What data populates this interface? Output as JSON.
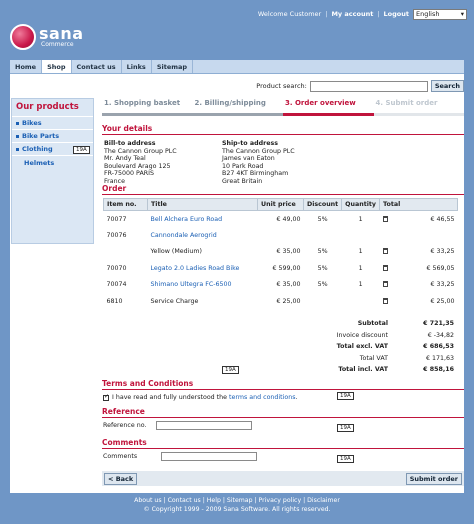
{
  "header": {
    "welcome": "Welcome Customer",
    "my_account": "My account",
    "logout": "Logout",
    "language": "English",
    "sep": "|",
    "logo_main": "sana",
    "logo_sub": "Commerce"
  },
  "nav": [
    "Home",
    "Shop",
    "Contact us",
    "Links",
    "Sitemap"
  ],
  "search": {
    "label": "Product search:",
    "button": "Search",
    "value": ""
  },
  "sidebar": {
    "title": "Our products",
    "items": [
      "Bikes",
      "Bike Parts",
      "Clothing"
    ],
    "sub": "Helmets",
    "tag": "19A"
  },
  "steps": [
    "1. Shopping basket",
    "2. Billing/shipping",
    "3. Order overview",
    "4. Submit order"
  ],
  "details": {
    "title": "Your details",
    "bill_title": "Bill-to address",
    "bill": [
      "The Cannon Group PLC",
      "Mr. Andy Teal",
      "Boulevard Arago 125",
      "FR-75000 PARIS",
      "France"
    ],
    "ship_title": "Ship-to address",
    "ship": [
      "The Cannon Group PLC",
      "James van Eaton",
      "10 Park Road",
      "B27 4KT Birmingham",
      "Great Britain"
    ]
  },
  "order": {
    "title": "Order",
    "headers": [
      "Item no.",
      "Title",
      "Unit price",
      "Discount",
      "Quantity",
      "Total"
    ],
    "rows": [
      {
        "item": "70077",
        "title": "Bell Alchera Euro Road",
        "link": true,
        "price": "€ 49,00",
        "disc": "5%",
        "qty": "1",
        "total": "€ 46,55",
        "trash": true
      },
      {
        "item": "70076",
        "title": "Cannondale Aerogrid",
        "link": true,
        "price": "",
        "disc": "",
        "qty": "",
        "total": "",
        "trash": false
      },
      {
        "item": "",
        "title": "Yellow (Medium)",
        "link": false,
        "price": "€ 35,00",
        "disc": "5%",
        "qty": "1",
        "total": "€ 33,25",
        "trash": true
      },
      {
        "item": "70070",
        "title": "Legato 2.0 Ladies Road Bike",
        "link": true,
        "price": "€ 599,00",
        "disc": "5%",
        "qty": "1",
        "total": "€ 569,05",
        "trash": true
      },
      {
        "item": "70074",
        "title": "Shimano Ultegra FC-6500",
        "link": true,
        "price": "€ 35,00",
        "disc": "5%",
        "qty": "1",
        "total": "€ 33,25",
        "trash": true
      },
      {
        "item": "6810",
        "title": "Service Charge",
        "link": false,
        "price": "€ 25,00",
        "disc": "",
        "qty": "",
        "total": "€ 25,00",
        "trash": true
      }
    ],
    "totals": [
      {
        "label": "Subtotal",
        "value": "€ 721,35",
        "bold": true
      },
      {
        "label": "Invoice discount",
        "value": "€ -34,82",
        "bold": false
      },
      {
        "label": "Total excl. VAT",
        "value": "€ 686,53",
        "bold": true
      },
      {
        "label": "Total VAT",
        "value": "€ 171,63",
        "bold": false
      },
      {
        "label": "Total incl. VAT",
        "value": "€ 858,16",
        "bold": true
      }
    ]
  },
  "terms": {
    "title": "Terms and Conditions",
    "text_pre": "I have read and fully understood the",
    "link": "terms and conditions",
    "text_post": "."
  },
  "reference": {
    "title": "Reference",
    "label": "Reference no."
  },
  "comments": {
    "title": "Comments",
    "label": "Comments"
  },
  "tags": [
    "19A",
    "19A",
    "19A",
    "19A"
  ],
  "buttons": {
    "back": "< Back",
    "submit": "Submit order"
  },
  "footer": {
    "links": "About us | Contact us | Help | Sitemap | Privacy policy | Disclaimer",
    "copyright": "© Copyright 1999 - 2009 Sana Software. All rights reserved."
  }
}
